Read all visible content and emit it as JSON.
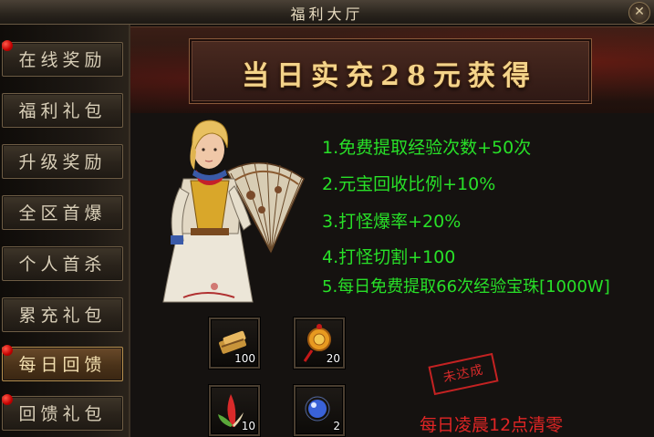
{
  "window": {
    "title": "福利大厅",
    "close_symbol": "✕"
  },
  "sidebar": {
    "items": [
      {
        "label": "在线奖励",
        "badge": true,
        "active": false
      },
      {
        "label": "福利礼包",
        "badge": false,
        "active": false
      },
      {
        "label": "升级奖励",
        "badge": false,
        "active": false
      },
      {
        "label": "全区首爆",
        "badge": false,
        "active": false
      },
      {
        "label": "个人首杀",
        "badge": false,
        "active": false
      },
      {
        "label": "累充礼包",
        "badge": false,
        "active": false
      },
      {
        "label": "每日回馈",
        "badge": true,
        "active": true
      },
      {
        "label": "回馈礼包",
        "badge": true,
        "active": false
      }
    ]
  },
  "banner": {
    "text": "当日实充28元获得"
  },
  "rewards": [
    "1.免费提取经验次数+50次",
    "2.元宝回收比例+10%",
    "3.打怪爆率+20%",
    "4.打怪切割+100",
    "5.每日免费提取66次经验宝珠[1000W]"
  ],
  "items": [
    {
      "icon": "gold-ingot-bundle-icon",
      "count": "100"
    },
    {
      "icon": "coin-charm-icon",
      "count": "20"
    },
    {
      "icon": "red-feather-icon",
      "count": "10"
    },
    {
      "icon": "blue-orb-icon",
      "count": "2"
    }
  ],
  "status": {
    "stamp": "未达成",
    "reset_note": "每日凌晨12点清零"
  },
  "colors": {
    "reward_text": "#28e028",
    "reset_note": "#e02525",
    "banner_text": "#f4d48a",
    "badge": "#c40000"
  }
}
